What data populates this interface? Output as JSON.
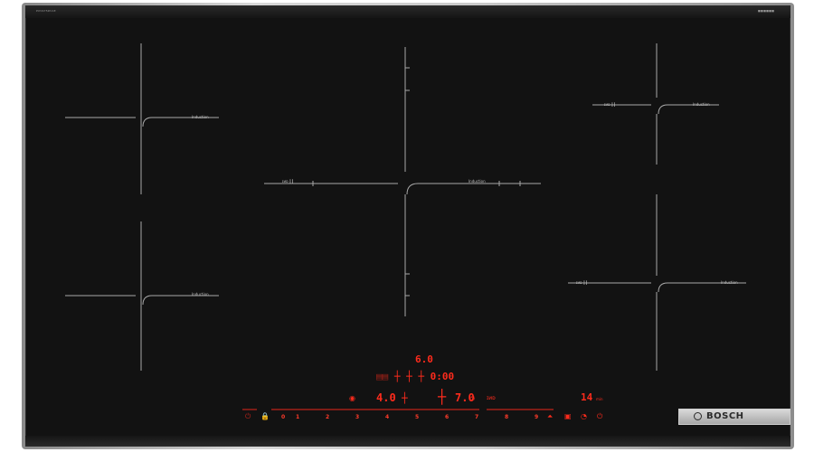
{
  "cooktop": {
    "brand": "BOSCH",
    "corner_left_text": "PXV975DV1E",
    "corner_right_text": "■■■■■■",
    "zone_labels": {
      "induction": "Induction",
      "combi": "ɪᴎᴅ ┃┃"
    }
  },
  "display": {
    "power_top": "6.0",
    "timer_row": "0:00",
    "left_level": "4.0",
    "right_level": "7.0",
    "timer_value": "14",
    "timer_unit": "min"
  },
  "slider": {
    "numbers": [
      "0",
      "1",
      "2",
      "3",
      "4",
      "5",
      "6",
      "7",
      "8",
      "9"
    ],
    "value": 0
  },
  "controls": {
    "power_icon": "power-icon",
    "lock_icon": "childlock-icon",
    "timer_icon": "timer-icon",
    "main_switch_icon": "main-switch-icon"
  },
  "colors": {
    "glass": "#121212",
    "display_red": "#ff2b1c",
    "frame": "#c9c9c9"
  }
}
